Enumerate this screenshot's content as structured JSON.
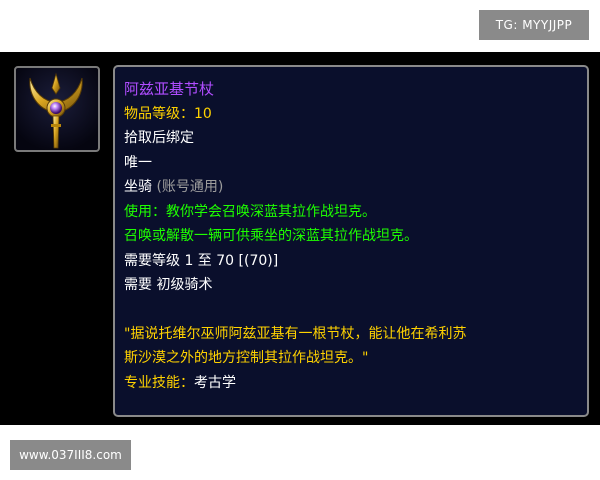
{
  "watermarks": {
    "top": "TG: MYYJJPP",
    "bottom": "www.037III8.com"
  },
  "item": {
    "icon": "golden-crescent-staff-icon",
    "name": "阿兹亚基节杖",
    "item_level_label": "物品等级：",
    "item_level_value": "10",
    "binding": "拾取后绑定",
    "unique": "唯一",
    "type": "坐骑",
    "type_note": "(账号通用)",
    "use_effect": "使用：教你学会召唤深蓝其拉作战坦克。",
    "use_desc": "召唤或解散一辆可供乘坐的深蓝其拉作战坦克。",
    "req_level_label": "需要等级",
    "req_level_value": "1 至 70 [(70)]",
    "req_skill_label": "需要",
    "req_skill_value": "初级骑术",
    "flavor_line1": "\"据说托维尔巫师阿兹亚基有一根节杖，能让他在希利苏",
    "flavor_line2": "斯沙漠之外的地方控制其拉作战坦克。\"",
    "profession_label": "专业技能：",
    "profession_value": "考古学"
  },
  "colors": {
    "name": "#b04dff",
    "yellow": "#ffd200",
    "green": "#1eff00",
    "gray": "#9d9d9d",
    "tooltip_bg": "#0a0f2c"
  }
}
